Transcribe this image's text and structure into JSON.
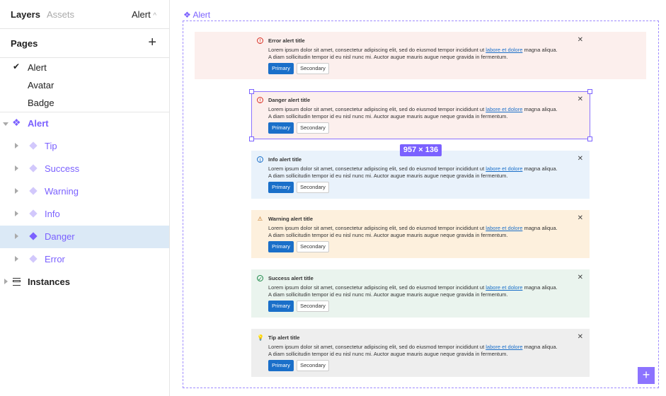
{
  "sidebar": {
    "tabs": {
      "layers": "Layers",
      "assets": "Assets",
      "current_page": "Alert"
    },
    "pages_title": "Pages",
    "pages": [
      "Alert",
      "Avatar",
      "Badge"
    ],
    "root_layer": "Alert",
    "layers": [
      "Tip",
      "Success",
      "Warning",
      "Info",
      "Danger",
      "Error"
    ],
    "selected_layer": "Danger",
    "instances": "Instances"
  },
  "canvas": {
    "frame_label": "Alert",
    "size_badge": "957 × 136",
    "accent": "#7b61ff"
  },
  "alert_body": {
    "pre": "Lorem ipsum dolor sit amet, consectetur adipiscing elit, sed do eiusmod tempor incididunt ut ",
    "link": "labore et dolore",
    "post": " magna aliqua. A diam sollicitudin tempor id eu nisl nunc mi. Auctor augue mauris augue neque gravida in fermentum.",
    "primary": "Primary",
    "secondary": "Secondary"
  },
  "alerts": [
    {
      "title": "Error alert title",
      "icon": "error-icon",
      "bg": "#fcefed",
      "color": "#d93025"
    },
    {
      "title": "Danger alert title",
      "icon": "danger-icon",
      "bg": "#fcefed",
      "color": "#d93025"
    },
    {
      "title": "Info alert title",
      "icon": "info-icon",
      "bg": "#e9f2fb",
      "color": "#1a6fc9"
    },
    {
      "title": "Warning alert title",
      "icon": "warning-icon",
      "bg": "#fdf0dd",
      "color": "#b8650a"
    },
    {
      "title": "Success alert title",
      "icon": "success-icon",
      "bg": "#eaf4ee",
      "color": "#1e8a4a"
    },
    {
      "title": "Tip alert title",
      "icon": "lightbulb-icon",
      "bg": "#eeeeee",
      "color": "#555555"
    }
  ]
}
